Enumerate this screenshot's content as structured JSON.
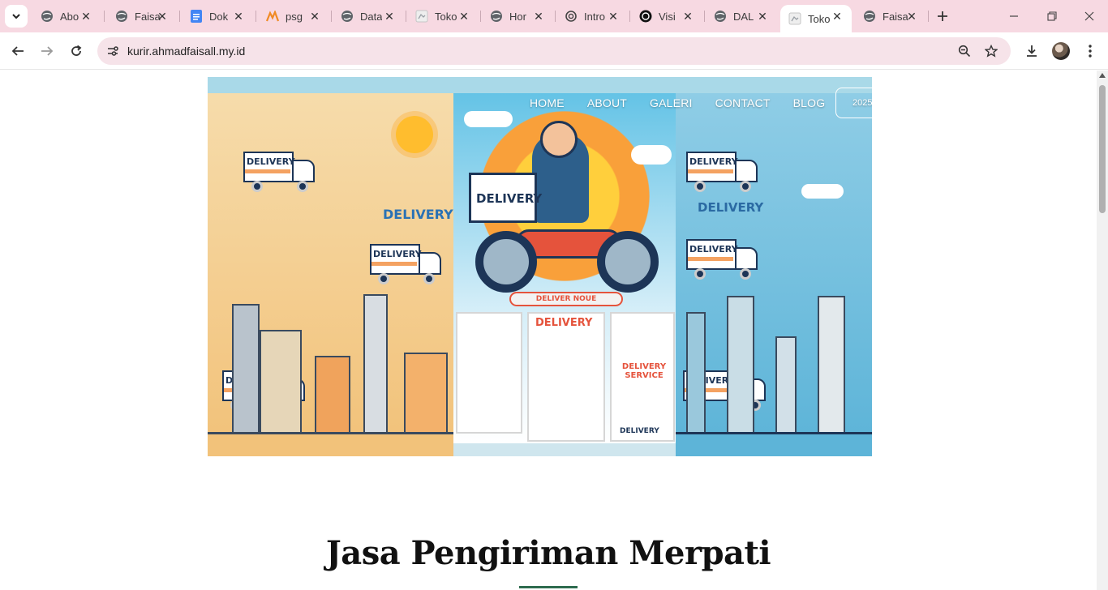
{
  "browser": {
    "tabs": [
      {
        "title": "Abo",
        "icon": "globe-icon"
      },
      {
        "title": "Faisa",
        "icon": "globe-icon"
      },
      {
        "title": "Dok",
        "icon": "docs-icon"
      },
      {
        "title": "psg",
        "icon": "psg-icon"
      },
      {
        "title": "Data",
        "icon": "globe-icon"
      },
      {
        "title": "Toko",
        "icon": "page-icon"
      },
      {
        "title": "Hor",
        "icon": "globe-icon"
      },
      {
        "title": "Intro",
        "icon": "openai-icon"
      },
      {
        "title": "Visi",
        "icon": "openai-icon"
      },
      {
        "title": "DAL",
        "icon": "globe-icon"
      },
      {
        "title": "Toko",
        "icon": "page-icon",
        "active": true
      },
      {
        "title": "Faisa",
        "icon": "globe-icon"
      }
    ],
    "url": "kurir.ahmadfaisall.my.id"
  },
  "hero": {
    "nav": [
      "HOME",
      "ABOUT",
      "GALERI",
      "CONTACT",
      "BLOG"
    ],
    "nav_button": "2025",
    "illustration": {
      "truck_label": "DELIVERY",
      "delivery_word": "DELIVERY",
      "ribbon": "DELIVER NOUE",
      "card_label": "DELIVERY",
      "service_label": "DELIVERY SERVICE",
      "small_label": "DELIVERY",
      "colors": {
        "left_panel": "#f2c27a",
        "center_panel": "#64c3e6",
        "right_panel": "#5db4d8",
        "accent_red": "#e5533c",
        "navy": "#1d3557"
      }
    }
  },
  "main": {
    "title": "Jasa Pengiriman Merpati"
  }
}
